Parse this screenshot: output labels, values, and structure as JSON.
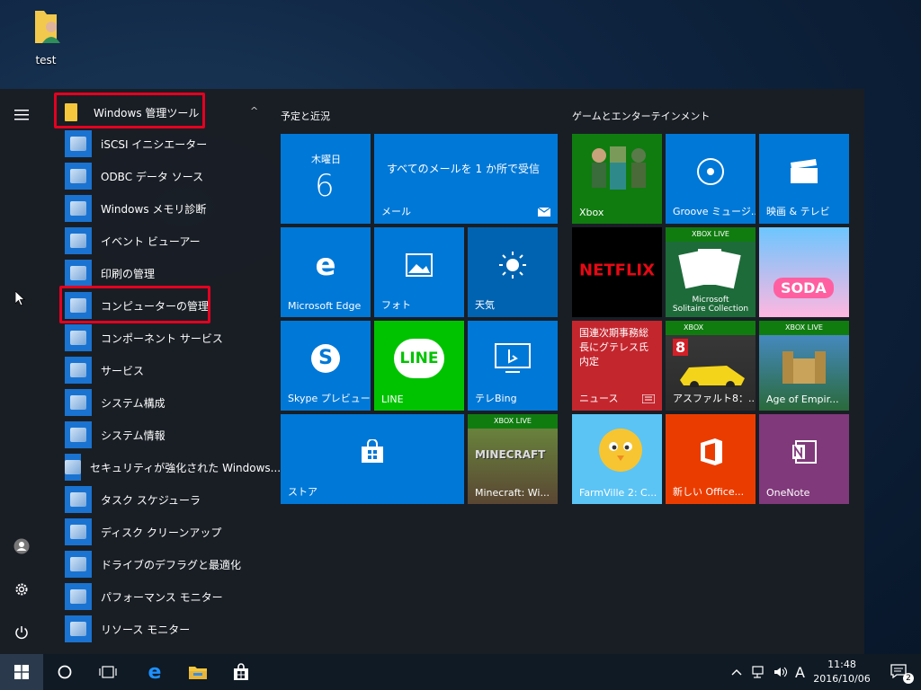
{
  "desktop": {
    "icon_label": "test"
  },
  "start": {
    "group_header": "Windows 管理ツール",
    "apps": [
      "iSCSI イニシエーター",
      "ODBC データ ソース",
      "Windows メモリ診断",
      "イベント ビューアー",
      "印刷の管理",
      "コンピューターの管理",
      "コンポーネント サービス",
      "サービス",
      "システム構成",
      "システム情報",
      "セキュリティが強化された Windows...",
      "タスク スケジューラ",
      "ディスク クリーンアップ",
      "ドライブのデフラグと最適化",
      "パフォーマンス モニター",
      "リソース モニター"
    ]
  },
  "tiles": {
    "section_left": "予定と近況",
    "section_right": "ゲームとエンターテインメント",
    "calendar_day": "木曜日",
    "calendar_date": "6",
    "mail_text": "すべてのメールを 1 か所で受信",
    "mail_label": "メール",
    "edge": "Microsoft Edge",
    "photos": "フォト",
    "weather": "天気",
    "skype": "Skype プレビュー",
    "line": "LINE",
    "line_logo": "LINE",
    "bing": "テレBing",
    "store": "ストア",
    "minecraft": "Minecraft: Wi...",
    "minecraft_logo": "MINECRAFT",
    "xbox": "Xbox",
    "groove": "Groove ミュージ...",
    "movies": "映画 & テレビ",
    "netflix": "NETFLIX",
    "solitaire_line1": "Microsoft",
    "solitaire_line2": "Solitaire Collection",
    "xbox_live": "XBOX LIVE",
    "xbox_badge": "XBOX",
    "candy_logo": "SODA",
    "news_text": "国連次期事務総長にグテレス氏内定",
    "news_label": "ニュース",
    "asphalt": "アスファルト8：...",
    "asphalt_num": "8",
    "age": "Age of Empir...",
    "farmville": "FarmVille 2: C...",
    "office": "新しい Office...",
    "onenote": "OneNote"
  },
  "taskbar": {
    "time": "11:48",
    "date": "2016/10/06",
    "ime": "A",
    "notifications": "2"
  },
  "colors": {
    "accent": "#0078d7",
    "highlight": "#e5001f",
    "line": "#00c300",
    "netflix": "#e50914",
    "onenote": "#80397b",
    "office": "#eb3c00"
  }
}
